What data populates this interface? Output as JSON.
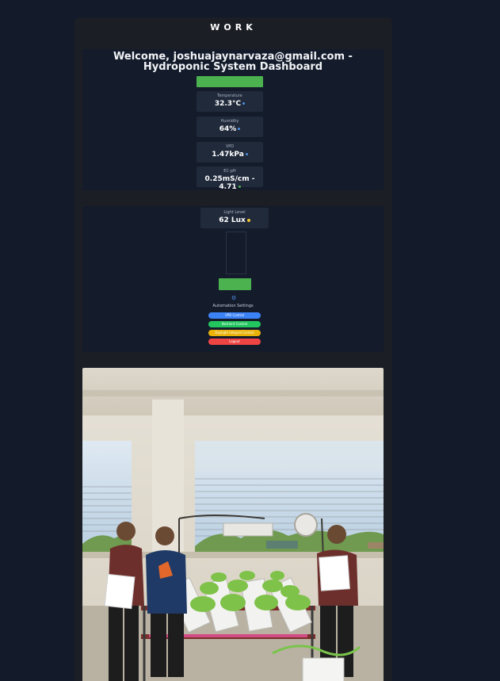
{
  "section": {
    "title": "WORK"
  },
  "dashboard": {
    "welcome": "Welcome, joshuajaynarvaza@gmail.com - Hydroponic System Dashboard",
    "top_button_label": "",
    "sensors": [
      {
        "label": "Temperature",
        "value": "32.3°C",
        "status_color": "#4a90e2"
      },
      {
        "label": "Humidity",
        "value": "64%",
        "status_color": "#4a90e2"
      },
      {
        "label": "VPD",
        "value": "1.47kPa",
        "status_color": "#4a90e2"
      },
      {
        "label": "EC-pH",
        "value": "0.25mS/cm - 4.71",
        "status_color": "#4bb24f"
      }
    ]
  },
  "controls": {
    "light": {
      "label": "Light Level",
      "value": "62 Lux",
      "status_color": "#f2c230"
    },
    "schedule_lines": [
      "",
      "",
      "",
      "",
      "",
      "",
      "",
      "",
      ""
    ],
    "save_button_label": "",
    "automation_title": "Automation Settings",
    "pills": [
      {
        "label": "VPD Control",
        "color": "#3b82f6"
      },
      {
        "label": "Nutrient Control",
        "color": "#22c55e"
      },
      {
        "label": "Daylight Integral Control",
        "color": "#eab308"
      },
      {
        "label": "Logout",
        "color": "#ef4444"
      }
    ]
  },
  "photo": {
    "alt": "Team photo with hydroponic system"
  },
  "colors": {
    "page_bg": "#131a2a",
    "panel_bg": "#1b1e24",
    "card_bg": "#141b2b",
    "accent_green": "#4bb24f"
  }
}
